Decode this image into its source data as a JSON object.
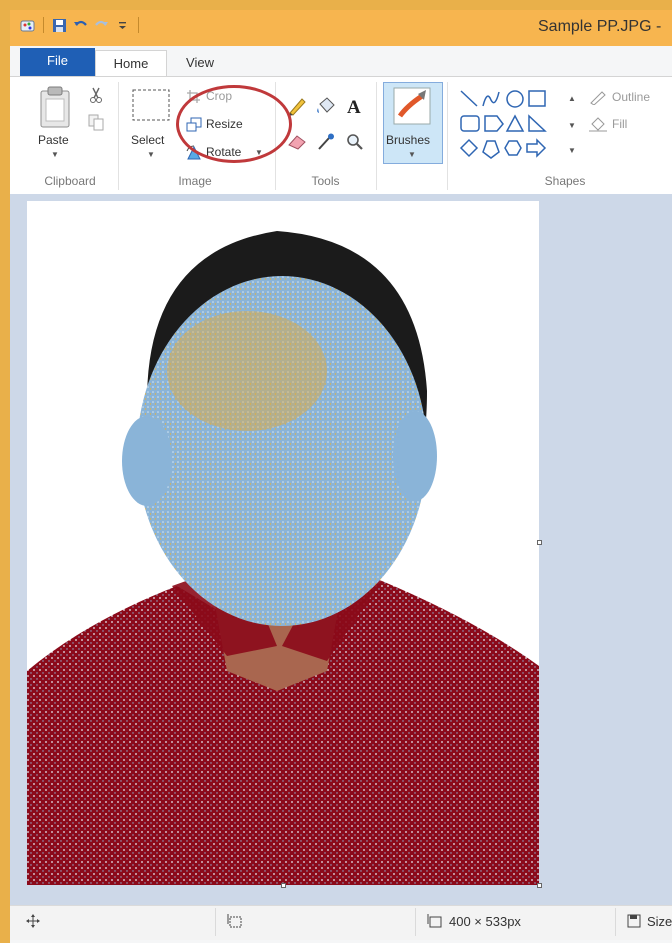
{
  "window": {
    "title": "Sample PP.JPG -"
  },
  "tabs": [
    {
      "label": "File"
    },
    {
      "label": "Home"
    },
    {
      "label": "View"
    }
  ],
  "ribbon": {
    "clipboard": {
      "paste": "Paste",
      "group": "Clipboard"
    },
    "image": {
      "select": "Select",
      "crop": "Crop",
      "resize": "Resize",
      "rotate": "Rotate",
      "group": "Image"
    },
    "tools": {
      "group": "Tools",
      "text_tool": "A"
    },
    "brushes": {
      "label": "Brushes"
    },
    "shapes": {
      "outline": "Outline",
      "fill": "Fill",
      "group": "Shapes"
    }
  },
  "status": {
    "image_size": "400 × 533px",
    "file_size": "Size"
  },
  "colors": {
    "titlebar": "#f7b54f",
    "file_tab": "#1f5fb5",
    "annotation": "#c0393b",
    "canvas_bg": "#cdd8e8",
    "shirt": "#8b0a1a",
    "hair": "#1b1b1b",
    "face_obscure": "#8ab4d8"
  },
  "icons": [
    "app-icon",
    "save-icon",
    "undo-icon",
    "redo-icon",
    "qat-dropdown-icon",
    "paste-icon",
    "cut-icon",
    "copy-icon",
    "select-icon",
    "crop-icon",
    "resize-icon",
    "rotate-icon",
    "pencil-icon",
    "fill-bucket-icon",
    "text-icon",
    "eraser-icon",
    "color-picker-icon",
    "magnifier-icon",
    "brushes-icon",
    "outline-icon",
    "fill-icon",
    "move-icon",
    "selection-size-icon",
    "image-size-icon",
    "file-size-icon"
  ]
}
